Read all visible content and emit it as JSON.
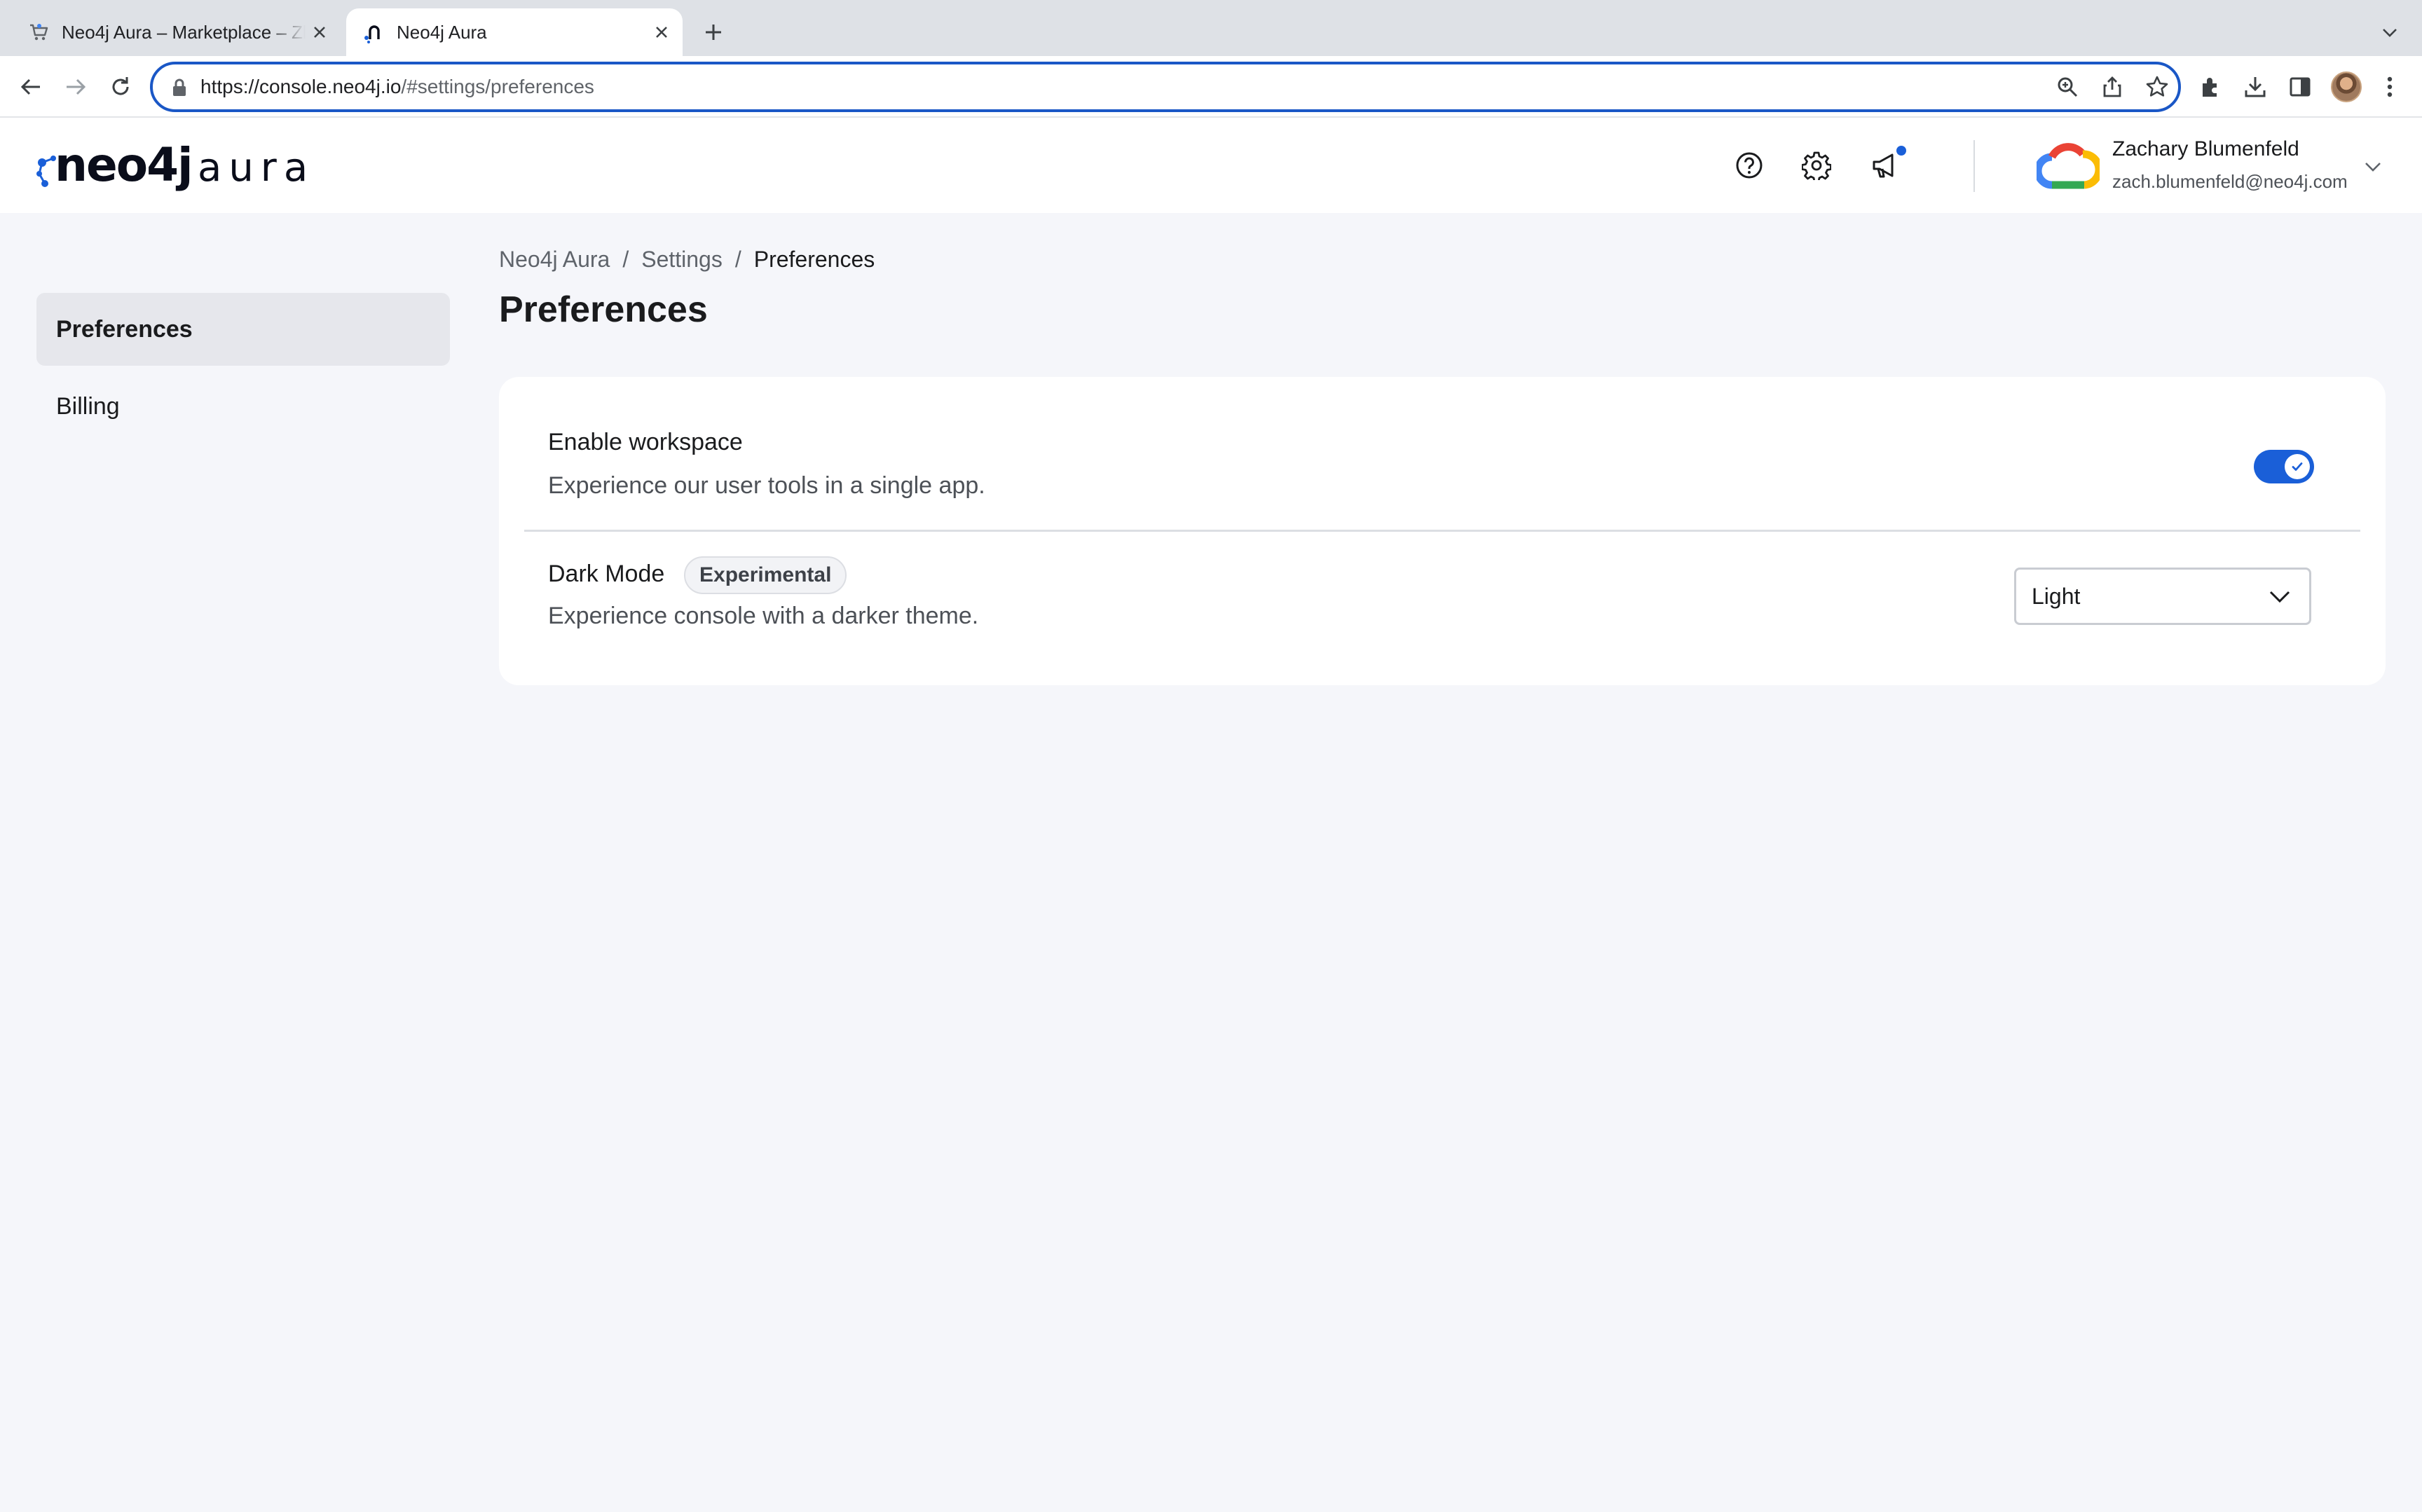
{
  "browser": {
    "tabs": [
      {
        "title": "Neo4j Aura – Marketplace – Zb",
        "active": false,
        "icon": "cart-icon"
      },
      {
        "title": "Neo4j Aura",
        "active": true,
        "icon": "neo4j-favicon"
      }
    ],
    "url_host": "https://console.neo4j.io",
    "url_path": "/#settings/preferences"
  },
  "header": {
    "logo_main": "neo4j",
    "logo_sub": "aura",
    "icons": [
      "help-icon",
      "settings-icon",
      "announcements-icon"
    ],
    "user": {
      "name": "Zachary Blumenfeld",
      "email": "zach.blumenfeld@neo4j.com"
    }
  },
  "sidebar": {
    "items": [
      {
        "label": "Preferences",
        "active": true
      },
      {
        "label": "Billing",
        "active": false
      }
    ]
  },
  "breadcrumb": {
    "items": [
      "Neo4j Aura",
      "Settings",
      "Preferences"
    ],
    "separator": "/"
  },
  "page": {
    "title": "Preferences"
  },
  "preferences": {
    "workspace": {
      "title": "Enable workspace",
      "description": "Experience our user tools in a single app.",
      "enabled": true
    },
    "dark_mode": {
      "title": "Dark Mode",
      "badge": "Experimental",
      "description": "Experience console with a darker theme.",
      "selected": "Light"
    }
  },
  "colors": {
    "accent": "#1a5fd8",
    "page_bg": "#f5f6fa",
    "omnibox_focus": "#1a57c6"
  }
}
